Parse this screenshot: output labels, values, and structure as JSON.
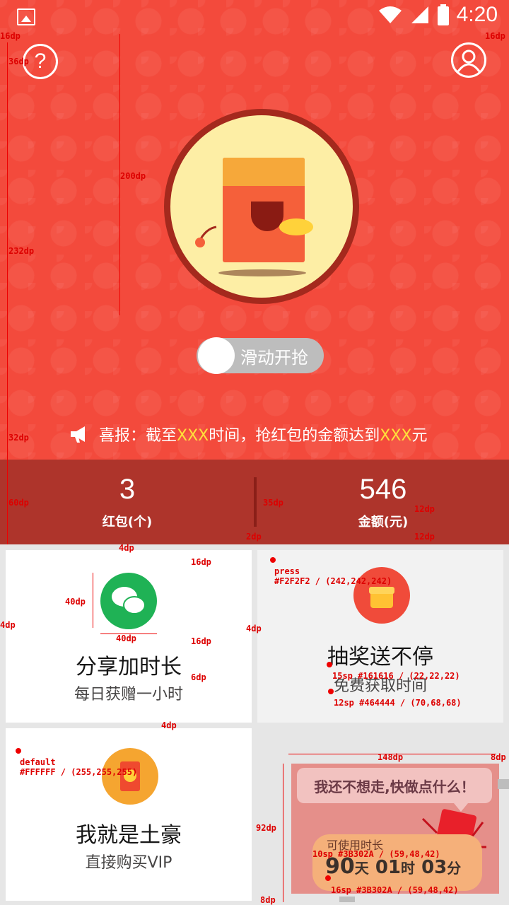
{
  "statusbar": {
    "time": "4:20"
  },
  "header": {
    "help_label": "?"
  },
  "slider": {
    "label": "滑动开抢"
  },
  "news": {
    "prefix": "喜报：截至",
    "hl1": "XXX",
    "middle": "时间，抢红包的金额达到",
    "hl2": "XXX",
    "suffix": "元"
  },
  "stats": {
    "left": {
      "value": "3",
      "label": "红包(个)"
    },
    "right": {
      "value": "546",
      "label": "金额(元)"
    }
  },
  "cards": [
    {
      "title": "分享加时长",
      "subtitle": "每日获赠一小时",
      "icon": "wechat-icon",
      "color": "#1fb255"
    },
    {
      "title": "抽奖送不停",
      "subtitle": "免费获取时间",
      "icon": "gift-icon",
      "color": "#f04b3a"
    },
    {
      "title": "我就是土豪",
      "subtitle": "直接购买VIP",
      "icon": "coin-envelope-icon",
      "color": "#f5a530"
    }
  ],
  "popup": {
    "bubble": "我还不想走,快做点什么！",
    "usable_label": "可使用时长",
    "days": "90",
    "days_unit": "天",
    "hours": "01",
    "hours_unit": "时",
    "minutes": "03",
    "minutes_unit": "分"
  },
  "annotations": {
    "a16dp_l": "16dp",
    "a36dp": "36dp",
    "a16dp_r": "16dp",
    "a200dp": "200dp",
    "a232dp": "232dp",
    "a32dp": "32dp",
    "a60dp": "60dp",
    "a35dp": "35dp",
    "a2dp": "2dp",
    "a12dp_1": "12dp",
    "a12dp_2": "12dp",
    "a4dp_top": "4dp",
    "a16dp_c1": "16dp",
    "a40dp_v": "40dp",
    "a40dp_h": "40dp",
    "a16dp_c2": "16dp",
    "a6dp": "6dp",
    "a4dp_left": "4dp",
    "a4dp_mid": "4dp",
    "press": "press",
    "press_color": "#F2F2F2 / (242,242,242)",
    "title_spec": "15sp #161616 / (22,22,22)",
    "sub_spec": "12sp #464444 / (70,68,68)",
    "a4dp_row2": "4dp",
    "default": "default",
    "default_color": "#FFFFFF / (255,255,255)",
    "a148dp": "148dp",
    "a8dp_r": "8dp",
    "a92dp": "92dp",
    "a8dp_b": "8dp",
    "usable_spec": "10sp #3B302A / (59,48,42)",
    "time_spec": "16sp #3B302A / (59,48,42)"
  }
}
